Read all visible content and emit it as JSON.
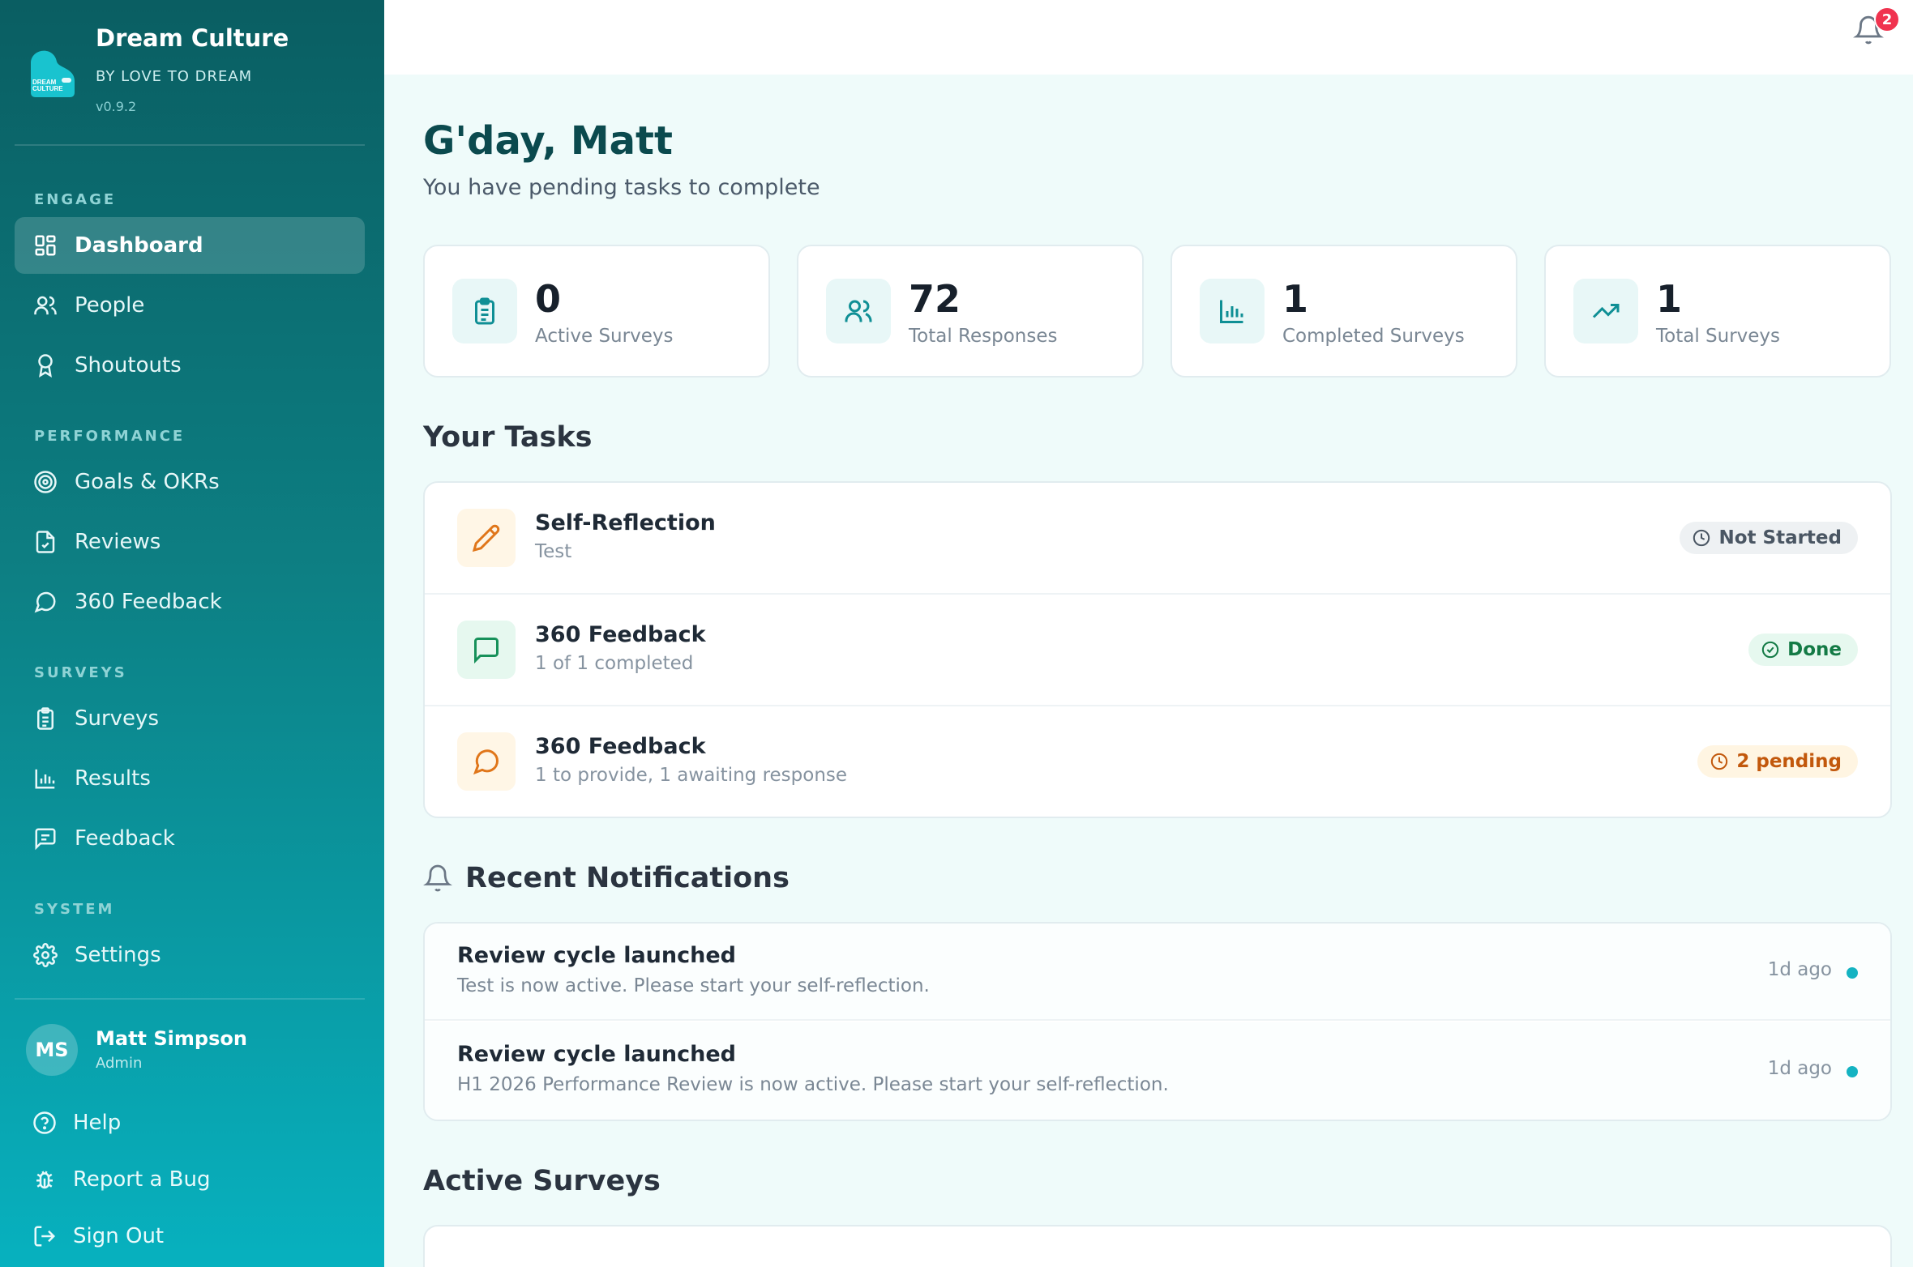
{
  "brand": {
    "title": "Dream Culture",
    "subtitle": "BY LOVE TO DREAM",
    "version": "v0.9.2",
    "logo_text_1": "DREAM",
    "logo_text_2": "CULTURE"
  },
  "sidebar": {
    "sections": [
      {
        "label": "ENGAGE",
        "items": [
          {
            "label": "Dashboard",
            "icon": "dashboard-icon",
            "active": true
          },
          {
            "label": "People",
            "icon": "people-icon"
          },
          {
            "label": "Shoutouts",
            "icon": "award-icon"
          }
        ]
      },
      {
        "label": "PERFORMANCE",
        "items": [
          {
            "label": "Goals & OKRs",
            "icon": "target-icon"
          },
          {
            "label": "Reviews",
            "icon": "review-doc-icon"
          },
          {
            "label": "360 Feedback",
            "icon": "message-circle-icon"
          }
        ]
      },
      {
        "label": "SURVEYS",
        "items": [
          {
            "label": "Surveys",
            "icon": "clipboard-icon"
          },
          {
            "label": "Results",
            "icon": "bar-chart-icon"
          },
          {
            "label": "Feedback",
            "icon": "message-square-icon"
          }
        ]
      },
      {
        "label": "SYSTEM",
        "items": [
          {
            "label": "Settings",
            "icon": "gear-icon"
          }
        ]
      }
    ],
    "user": {
      "initials": "MS",
      "name": "Matt Simpson",
      "role": "Admin"
    },
    "footer": [
      {
        "label": "Help",
        "icon": "help-circle-icon"
      },
      {
        "label": "Report a Bug",
        "icon": "bug-icon"
      },
      {
        "label": "Sign Out",
        "icon": "sign-out-icon"
      }
    ]
  },
  "topbar": {
    "notification_count": "2"
  },
  "header": {
    "greeting": "G'day, Matt",
    "subtitle": "You have pending tasks to complete"
  },
  "stats": [
    {
      "value": "0",
      "label": "Active Surveys",
      "icon": "clipboard-icon"
    },
    {
      "value": "72",
      "label": "Total Responses",
      "icon": "users-icon"
    },
    {
      "value": "1",
      "label": "Completed Surveys",
      "icon": "bar-chart-icon"
    },
    {
      "value": "1",
      "label": "Total Surveys",
      "icon": "trending-up-icon"
    }
  ],
  "tasks": {
    "title": "Your Tasks",
    "items": [
      {
        "title": "Self-Reflection",
        "subtitle": "Test",
        "status": "Not Started",
        "icon": "pencil-icon"
      },
      {
        "title": "360 Feedback",
        "subtitle": "1 of 1 completed",
        "status": "Done",
        "icon": "message-square-icon"
      },
      {
        "title": "360 Feedback",
        "subtitle": "1 to provide, 1 awaiting response",
        "status": "2 pending",
        "icon": "message-circle-icon"
      }
    ]
  },
  "notifications": {
    "title": "Recent Notifications",
    "items": [
      {
        "title": "Review cycle launched",
        "subtitle": "Test is now active. Please start your self-reflection.",
        "time": "1d ago"
      },
      {
        "title": "Review cycle launched",
        "subtitle": "H1 2026 Performance Review is now active. Please start your self-reflection.",
        "time": "1d ago"
      }
    ]
  },
  "active_surveys": {
    "title": "Active Surveys"
  },
  "colors": {
    "teal_dark": "#0a5e62",
    "teal_light": "#07b1bf",
    "accent": "#14b3c2",
    "badge_red": "#f0334f",
    "done_green": "#137a45",
    "pending_amber": "#c2580c"
  }
}
